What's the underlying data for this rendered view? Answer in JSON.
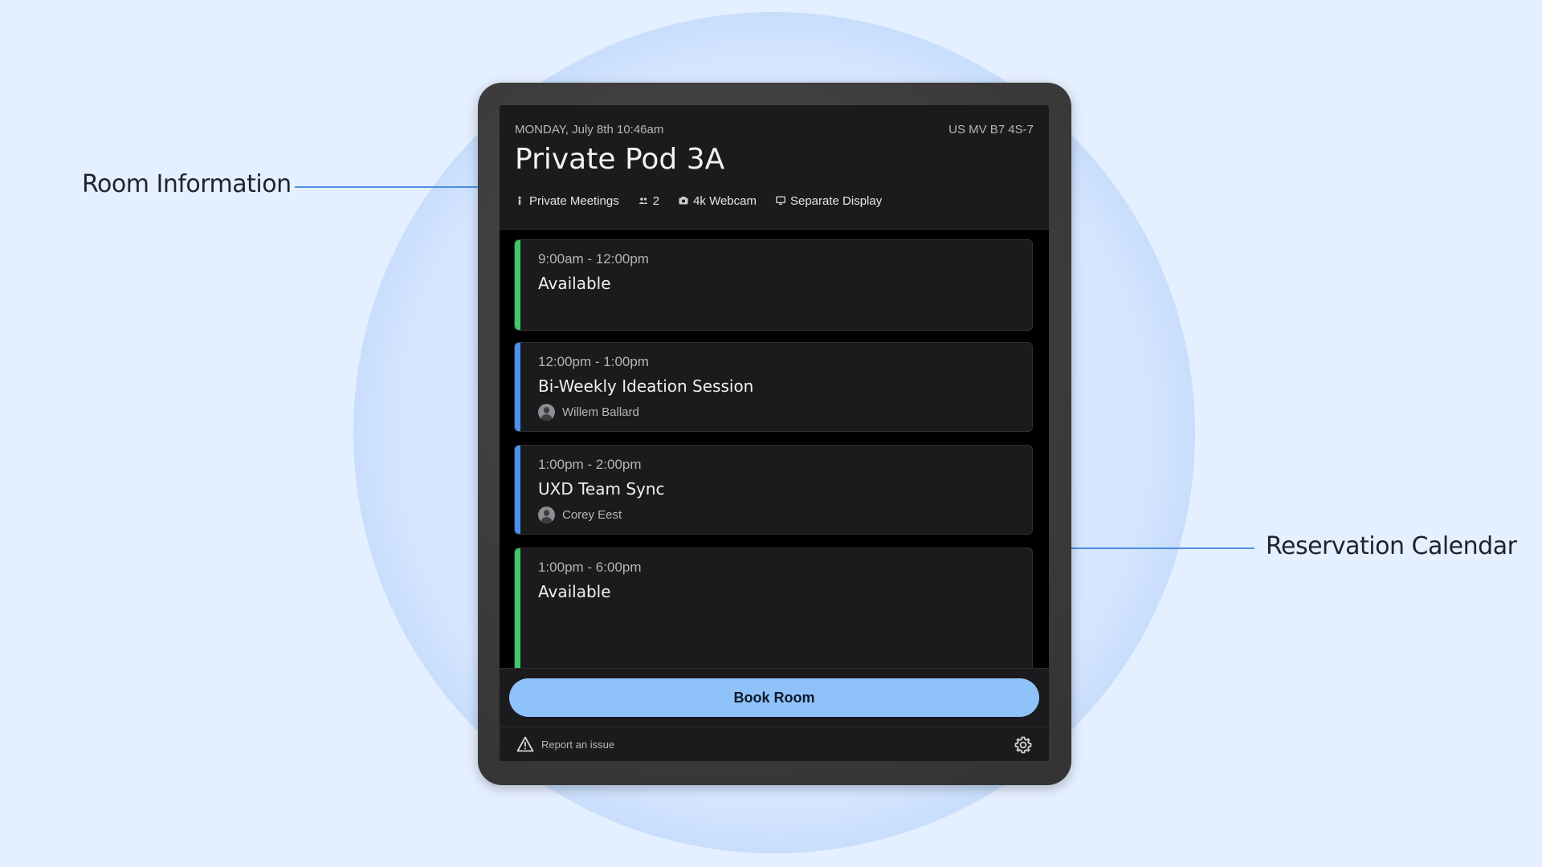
{
  "annotations": {
    "room_info": "Room Information",
    "reservation_calendar": "Reservation Calendar"
  },
  "header": {
    "date": "MONDAY, July 8th 10:46am",
    "room_id": "US MV B7 4S-7",
    "title": "Private Pod 3A",
    "features": [
      {
        "icon": "person-icon",
        "label": "Private Meetings"
      },
      {
        "icon": "people-icon",
        "label": "2"
      },
      {
        "icon": "camera-icon",
        "label": "4k Webcam"
      },
      {
        "icon": "monitor-icon",
        "label": "Separate Display"
      }
    ]
  },
  "slots": [
    {
      "time": "9:00am - 12:00pm",
      "title": "Available",
      "status": "available",
      "color": "#3ec96a"
    },
    {
      "time": "12:00pm - 1:00pm",
      "title": "Bi-Weekly Ideation Session",
      "host": "Willem Ballard",
      "status": "booked",
      "color": "#4a8ff0"
    },
    {
      "time": "1:00pm - 2:00pm",
      "title": "UXD Team Sync",
      "host": "Corey Eest",
      "status": "booked",
      "color": "#4a8ff0"
    },
    {
      "time": "1:00pm - 6:00pm",
      "title": "Available",
      "status": "available",
      "color": "#3ec96a"
    }
  ],
  "footer": {
    "book_label": "Book Room",
    "report_label": "Report an issue",
    "settings_icon": "gear-icon",
    "button_color": "#90c2fa"
  }
}
